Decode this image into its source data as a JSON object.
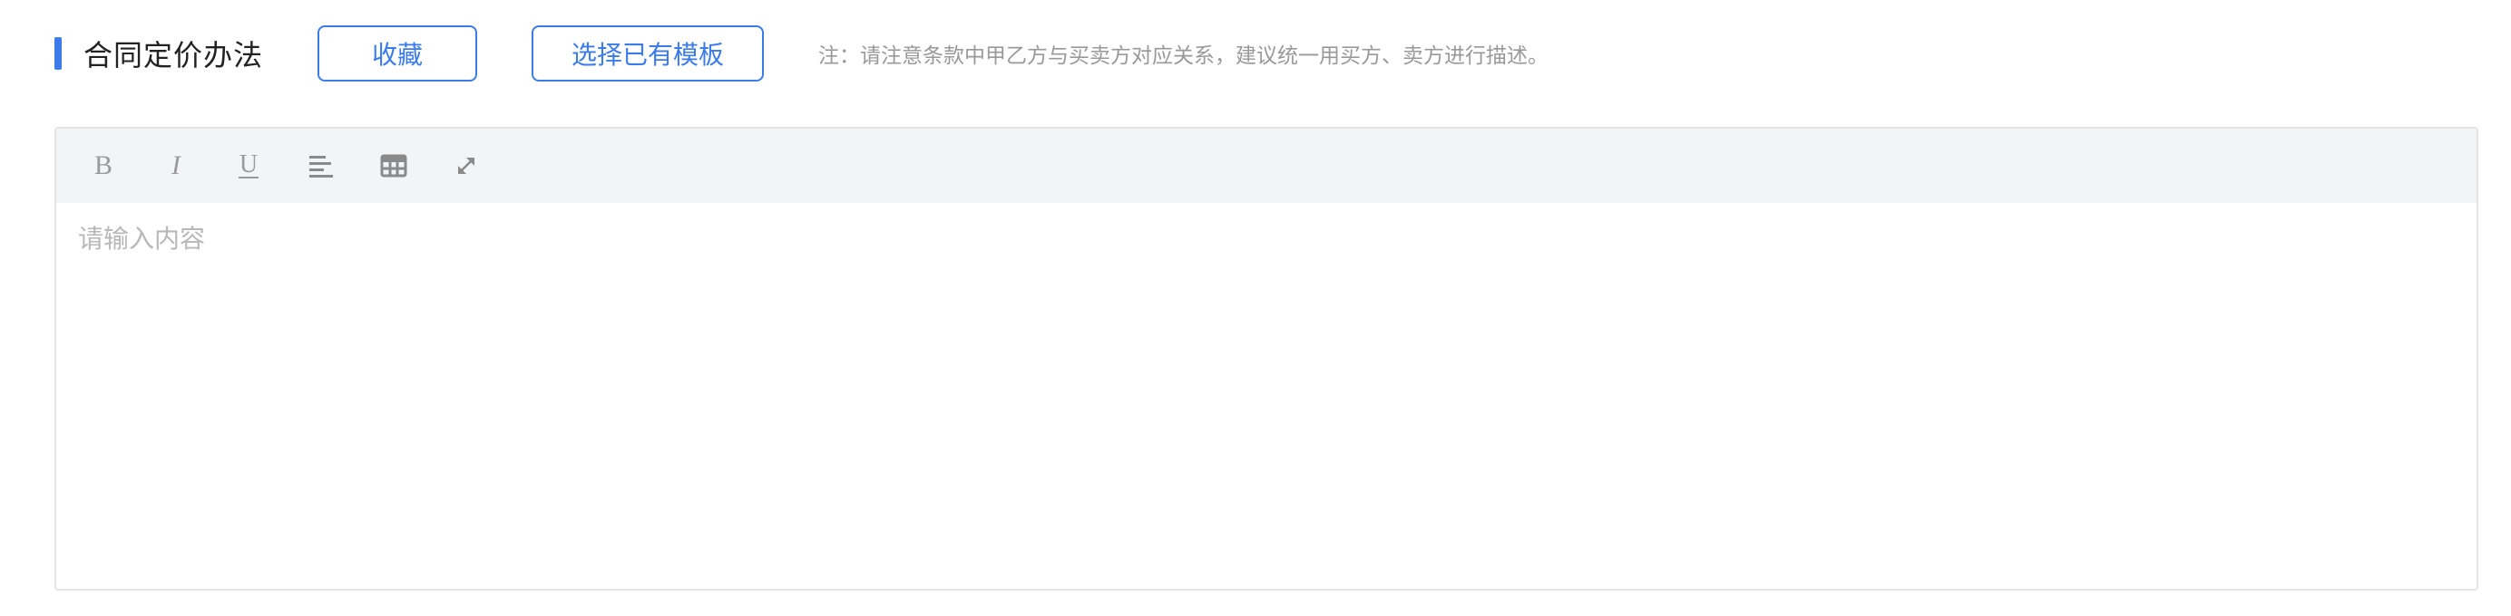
{
  "section": {
    "title": "合同定价办法",
    "accent_color": "#3b7bea"
  },
  "buttons": {
    "favorite_label": "收藏",
    "select_template_label": "选择已有模板"
  },
  "note": "注：请注意条款中甲乙方与买卖方对应关系，建议统一用买方、卖方进行描述。",
  "editor": {
    "toolbar": [
      {
        "name": "bold-button",
        "icon": "bold-icon"
      },
      {
        "name": "italic-button",
        "icon": "italic-icon"
      },
      {
        "name": "underline-button",
        "icon": "underline-icon"
      },
      {
        "name": "align-left-button",
        "icon": "align-left-icon"
      },
      {
        "name": "table-button",
        "icon": "table-icon"
      },
      {
        "name": "fullscreen-button",
        "icon": "expand-icon"
      }
    ],
    "placeholder": "请输入内容",
    "value": ""
  }
}
